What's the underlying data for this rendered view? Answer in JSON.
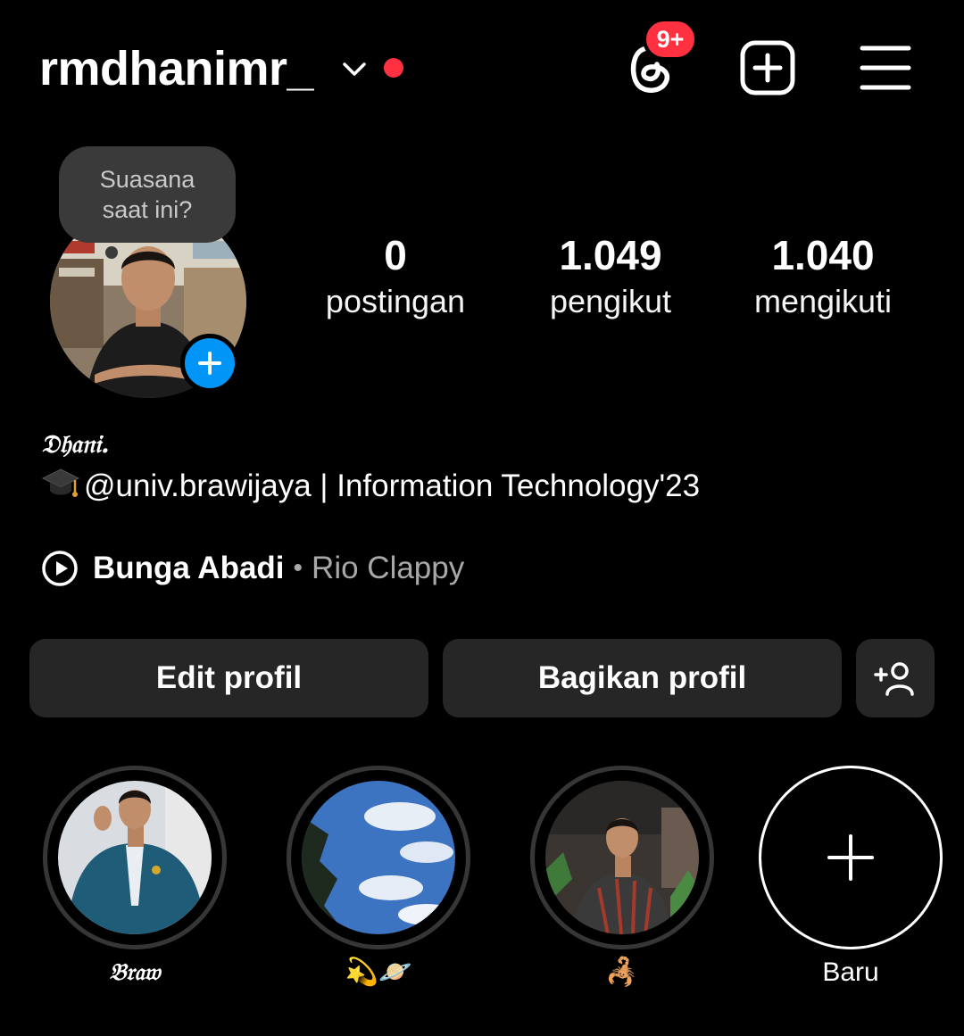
{
  "header": {
    "username": "rmdhanimr_",
    "threads_badge": "9+"
  },
  "note": {
    "text": "Suasana saat ini?"
  },
  "stats": [
    {
      "value": "0",
      "label": "postingan"
    },
    {
      "value": "1.049",
      "label": "pengikut"
    },
    {
      "value": "1.040",
      "label": "mengikuti"
    }
  ],
  "bio": {
    "display_name": "𝔇𝔥𝔞𝔫𝔦.",
    "line": "@univ.brawijaya | Information Technology'23"
  },
  "music": {
    "song": "Bunga Abadi",
    "separator": "•",
    "artist": "Rio Clappy"
  },
  "buttons": {
    "edit": "Edit profil",
    "share": "Bagikan profil"
  },
  "highlights": [
    {
      "label": "𝔅𝔯𝔞𝔴"
    },
    {
      "label": "💫🪐"
    },
    {
      "label": "🦂"
    },
    {
      "label": "Baru"
    }
  ],
  "colors": {
    "background": "#000000",
    "notification_red": "#ff3040",
    "add_blue": "#0095f6",
    "button_gray": "#262626",
    "secondary_text": "#a8a8a8"
  },
  "icons": [
    "chevron-down-icon",
    "threads-icon",
    "create-plus-icon",
    "hamburger-menu-icon",
    "add-story-plus-icon",
    "play-icon",
    "graduation-cap-icon",
    "add-person-icon",
    "new-highlight-plus-icon"
  ]
}
